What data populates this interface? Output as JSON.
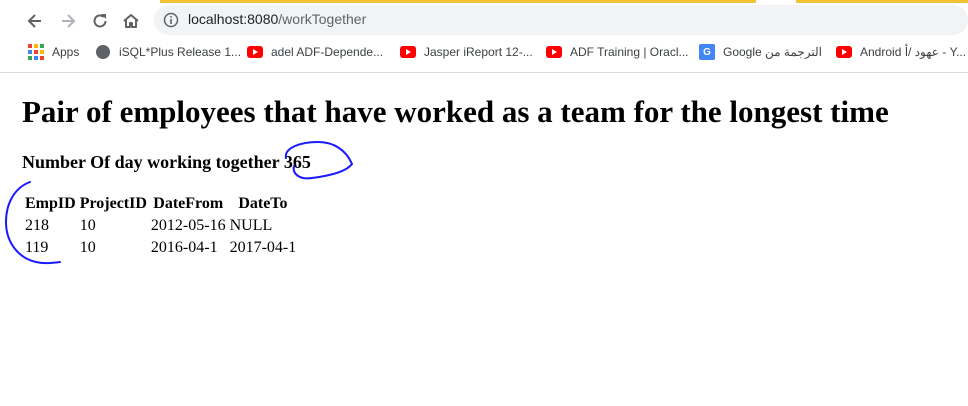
{
  "browser": {
    "url_host": "localhost:8080",
    "url_path": "/workTogether",
    "accent_color": "#f1c232",
    "bookmarks": [
      {
        "label": "Apps",
        "icon": "apps-grid-icon"
      },
      {
        "label": "iSQL*Plus Release 1...",
        "icon": "globe-icon"
      },
      {
        "label": "adel ADF-Depende...",
        "icon": "youtube-icon"
      },
      {
        "label": "Jasper iReport 12-...",
        "icon": "youtube-icon"
      },
      {
        "label": "ADF Training | Oracl...",
        "icon": "youtube-icon"
      },
      {
        "label": "Google الترجمة من",
        "icon": "google-translate-icon"
      },
      {
        "label": "Android عهود /أ - Y...",
        "icon": "youtube-icon"
      }
    ]
  },
  "page": {
    "title": "Pair of employees that have worked as a team for the longest time",
    "days_label": "Number Of day working together",
    "days_value": "365",
    "table": {
      "headers": [
        "EmpID",
        "ProjectID",
        "DateFrom",
        "DateTo"
      ],
      "rows": [
        [
          "218",
          "10",
          "2012-05-16",
          "NULL"
        ],
        [
          "119",
          "10",
          "2016-04-1",
          "2017-04-1"
        ]
      ]
    },
    "annotation_color": "#1a1aff"
  }
}
